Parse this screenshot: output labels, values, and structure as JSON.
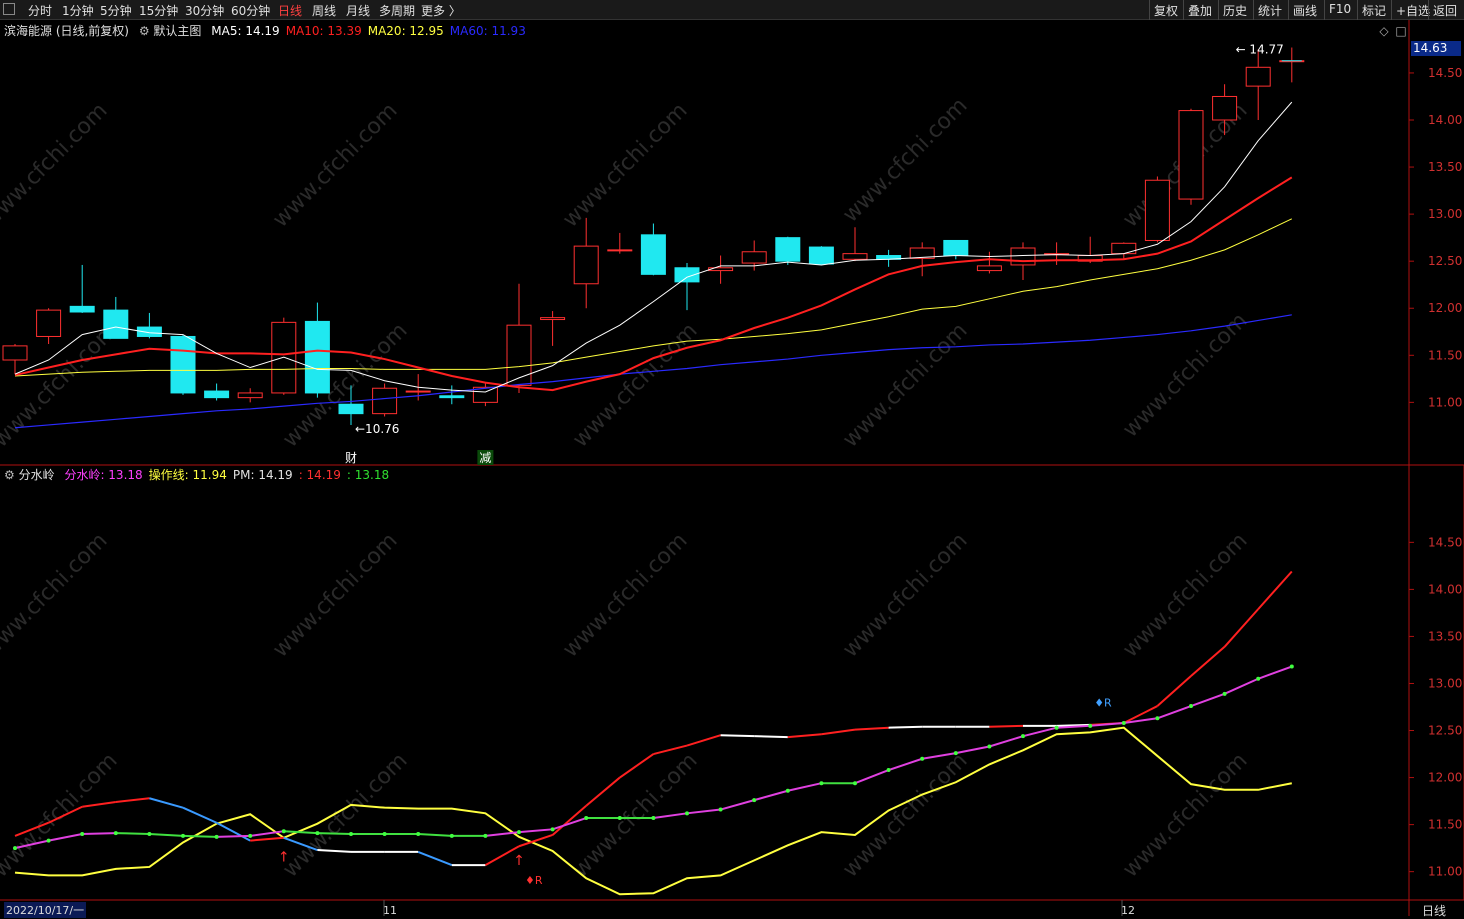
{
  "toolbar": {
    "left_items": [
      "分时",
      "1分钟",
      "5分钟",
      "15分钟",
      "30分钟",
      "60分钟",
      "日线",
      "周线",
      "月线",
      "多周期",
      "更多 〉"
    ],
    "active_item": "日线",
    "right_items": [
      "复权",
      "叠加",
      "历史",
      "统计",
      "画线",
      "F10",
      "标记",
      "+自选",
      "返回"
    ]
  },
  "main_panel": {
    "stock_title": "滨海能源 (日线,前复权)",
    "template_label": "默认主图",
    "ma": [
      {
        "label": "MA5: 14.19",
        "color": "#ffffff"
      },
      {
        "label": "MA10: 13.39",
        "color": "#ff2020"
      },
      {
        "label": "MA20: 12.95",
        "color": "#ffff40"
      },
      {
        "label": "MA60: 11.93",
        "color": "#2a2aff"
      }
    ],
    "current_price_tag": "14.63",
    "high_annotation": "14.77",
    "low_annotation": "10.76",
    "event_markers": [
      "财",
      "减"
    ]
  },
  "sub_panel": {
    "indicator_name": "分水岭",
    "values": [
      {
        "label": "分水岭: 13.18",
        "color": "#ff40ff"
      },
      {
        "label": "操作线: 11.94",
        "color": "#ffff40"
      },
      {
        "label": "PM: 14.19",
        "color": "#e0e0e0"
      },
      {
        "label": ": 14.19",
        "color": "#ff3030"
      },
      {
        "label": ": 13.18",
        "color": "#30e030"
      }
    ],
    "signal_labels": [
      "R",
      "R"
    ]
  },
  "footer": {
    "start_date": "2022/10/17/一",
    "month_labels": [
      "11",
      "12"
    ],
    "period": "日线"
  },
  "watermark": "www.cfchi.com",
  "chart_data": [
    {
      "type": "candlestick",
      "title": "滨海能源 (日线,前复权)",
      "ylim": [
        10.6,
        14.85
      ],
      "y_ticks": [
        11.0,
        11.5,
        12.0,
        12.5,
        13.0,
        13.5,
        14.0,
        14.5
      ],
      "candles": [
        {
          "o": 11.45,
          "h": 11.62,
          "l": 11.3,
          "c": 11.6
        },
        {
          "o": 11.7,
          "h": 12.0,
          "l": 11.62,
          "c": 11.98
        },
        {
          "o": 12.02,
          "h": 12.46,
          "l": 11.95,
          "c": 11.96
        },
        {
          "o": 11.98,
          "h": 12.12,
          "l": 11.68,
          "c": 11.68
        },
        {
          "o": 11.8,
          "h": 11.95,
          "l": 11.68,
          "c": 11.7
        },
        {
          "o": 11.7,
          "h": 11.72,
          "l": 11.08,
          "c": 11.1
        },
        {
          "o": 11.12,
          "h": 11.2,
          "l": 11.02,
          "c": 11.05
        },
        {
          "o": 11.05,
          "h": 11.15,
          "l": 11.0,
          "c": 11.1
        },
        {
          "o": 11.1,
          "h": 11.9,
          "l": 11.08,
          "c": 11.85
        },
        {
          "o": 11.86,
          "h": 12.06,
          "l": 11.05,
          "c": 11.1
        },
        {
          "o": 10.98,
          "h": 11.18,
          "l": 10.76,
          "c": 10.88
        },
        {
          "o": 10.88,
          "h": 11.2,
          "l": 10.85,
          "c": 11.15
        },
        {
          "o": 11.12,
          "h": 11.3,
          "l": 11.02,
          "c": 11.12
        },
        {
          "o": 11.07,
          "h": 11.18,
          "l": 10.98,
          "c": 11.05
        },
        {
          "o": 11.0,
          "h": 11.2,
          "l": 10.96,
          "c": 11.16
        },
        {
          "o": 11.18,
          "h": 12.26,
          "l": 11.1,
          "c": 11.82
        },
        {
          "o": 11.88,
          "h": 11.97,
          "l": 11.6,
          "c": 11.9
        },
        {
          "o": 12.26,
          "h": 12.96,
          "l": 12.0,
          "c": 12.66
        },
        {
          "o": 12.62,
          "h": 12.8,
          "l": 12.58,
          "c": 12.62
        },
        {
          "o": 12.78,
          "h": 12.9,
          "l": 12.35,
          "c": 12.36
        },
        {
          "o": 12.43,
          "h": 12.48,
          "l": 11.98,
          "c": 12.28
        },
        {
          "o": 12.4,
          "h": 12.56,
          "l": 12.26,
          "c": 12.43
        },
        {
          "o": 12.48,
          "h": 12.72,
          "l": 12.4,
          "c": 12.6
        },
        {
          "o": 12.75,
          "h": 12.76,
          "l": 12.46,
          "c": 12.5
        },
        {
          "o": 12.65,
          "h": 12.66,
          "l": 12.47,
          "c": 12.47
        },
        {
          "o": 12.52,
          "h": 12.86,
          "l": 12.5,
          "c": 12.58
        },
        {
          "o": 12.56,
          "h": 12.62,
          "l": 12.44,
          "c": 12.52
        },
        {
          "o": 12.53,
          "h": 12.7,
          "l": 12.34,
          "c": 12.64
        },
        {
          "o": 12.72,
          "h": 12.72,
          "l": 12.52,
          "c": 12.56
        },
        {
          "o": 12.4,
          "h": 12.6,
          "l": 12.37,
          "c": 12.45
        },
        {
          "o": 12.46,
          "h": 12.7,
          "l": 12.3,
          "c": 12.64
        },
        {
          "o": 12.58,
          "h": 12.7,
          "l": 12.46,
          "c": 12.58
        },
        {
          "o": 12.5,
          "h": 12.76,
          "l": 12.48,
          "c": 12.56
        },
        {
          "o": 12.58,
          "h": 12.7,
          "l": 12.52,
          "c": 12.69
        },
        {
          "o": 12.72,
          "h": 13.4,
          "l": 12.7,
          "c": 13.36
        },
        {
          "o": 13.16,
          "h": 14.12,
          "l": 13.1,
          "c": 14.1
        },
        {
          "o": 14.0,
          "h": 14.38,
          "l": 13.84,
          "c": 14.25
        },
        {
          "o": 14.36,
          "h": 14.75,
          "l": 14.0,
          "c": 14.56
        },
        {
          "o": 14.63,
          "h": 14.77,
          "l": 14.4,
          "c": 14.63
        }
      ],
      "ma5": [
        11.3,
        11.45,
        11.72,
        11.8,
        11.74,
        11.72,
        11.52,
        11.37,
        11.48,
        11.35,
        11.34,
        11.23,
        11.16,
        11.13,
        11.11,
        11.26,
        11.39,
        11.63,
        11.82,
        12.07,
        12.33,
        12.45,
        12.45,
        12.49,
        12.46,
        12.51,
        12.52,
        12.54,
        12.56,
        12.55,
        12.56,
        12.57,
        12.56,
        12.58,
        12.68,
        12.92,
        13.29,
        13.78,
        14.19
      ],
      "ma10": [
        11.29,
        11.37,
        11.45,
        11.51,
        11.57,
        11.55,
        11.52,
        11.52,
        11.51,
        11.55,
        11.53,
        11.46,
        11.37,
        11.28,
        11.21,
        11.16,
        11.13,
        11.22,
        11.3,
        11.47,
        11.58,
        11.66,
        11.79,
        11.9,
        12.03,
        12.2,
        12.36,
        12.45,
        12.49,
        12.52,
        12.5,
        12.51,
        12.51,
        12.52,
        12.58,
        12.71,
        12.94,
        13.17,
        13.39
      ],
      "ma20": [
        11.28,
        11.3,
        11.32,
        11.33,
        11.34,
        11.34,
        11.34,
        11.35,
        11.35,
        11.36,
        11.36,
        11.35,
        11.35,
        11.35,
        11.35,
        11.38,
        11.42,
        11.48,
        11.54,
        11.6,
        11.65,
        11.67,
        11.7,
        11.73,
        11.77,
        11.84,
        11.91,
        11.99,
        12.02,
        12.1,
        12.18,
        12.23,
        12.3,
        12.36,
        12.42,
        12.51,
        12.62,
        12.78,
        12.95
      ],
      "ma60": [
        10.73,
        10.76,
        10.79,
        10.82,
        10.85,
        10.88,
        10.91,
        10.93,
        10.96,
        10.99,
        11.01,
        11.04,
        11.07,
        11.11,
        11.15,
        11.19,
        11.22,
        11.26,
        11.3,
        11.33,
        11.36,
        11.4,
        11.43,
        11.46,
        11.5,
        11.53,
        11.56,
        11.58,
        11.59,
        11.61,
        11.62,
        11.64,
        11.66,
        11.69,
        11.72,
        11.76,
        11.81,
        11.87,
        11.93
      ]
    },
    {
      "type": "line",
      "title": "分水岭",
      "ylim": [
        10.72,
        15.12
      ],
      "y_ticks": [
        11.0,
        11.5,
        12.0,
        12.5,
        13.0,
        13.5,
        14.0,
        14.5
      ],
      "series": [
        {
          "name": "分水岭",
          "color": "#e040e0",
          "values": [
            11.25,
            11.33,
            11.4,
            11.41,
            11.4,
            11.38,
            11.37,
            11.38,
            11.43,
            11.41,
            11.4,
            11.4,
            11.4,
            11.38,
            11.38,
            11.42,
            11.45,
            11.57,
            11.57,
            11.57,
            11.62,
            11.66,
            11.76,
            11.86,
            11.94,
            11.94,
            12.08,
            12.2,
            12.26,
            12.33,
            12.44,
            12.53,
            12.55,
            12.58,
            12.63,
            12.76,
            12.89,
            13.05,
            13.18
          ]
        },
        {
          "name": "操作线",
          "color": "#ffff40",
          "values": [
            10.99,
            10.96,
            10.96,
            11.03,
            11.05,
            11.31,
            11.51,
            11.61,
            11.36,
            11.51,
            11.71,
            11.68,
            11.67,
            11.67,
            11.62,
            11.37,
            11.22,
            10.93,
            10.76,
            10.77,
            10.93,
            10.96,
            11.12,
            11.28,
            11.42,
            11.39,
            11.65,
            11.82,
            11.95,
            12.14,
            12.29,
            12.46,
            12.48,
            12.53,
            12.23,
            11.93,
            11.87,
            11.87,
            11.94
          ]
        },
        {
          "name": "PM",
          "color": "#e02020",
          "values": [
            11.38,
            11.52,
            11.69,
            11.74,
            11.78,
            11.68,
            11.52,
            11.33,
            11.36,
            11.23,
            11.21,
            11.21,
            11.21,
            11.07,
            11.07,
            11.27,
            11.39,
            11.7,
            12.0,
            12.25,
            12.34,
            12.45,
            12.44,
            12.43,
            12.46,
            12.51,
            12.53,
            12.54,
            12.54,
            12.54,
            12.55,
            12.55,
            12.56,
            12.58,
            12.76,
            13.08,
            13.39,
            13.79,
            14.19
          ]
        }
      ]
    }
  ]
}
